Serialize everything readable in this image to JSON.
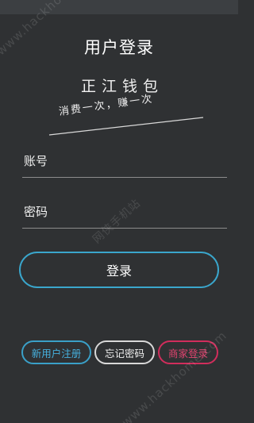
{
  "header": {
    "title": "用户登录"
  },
  "logo": {
    "name": "正江钱包",
    "slogan": "消费一次，赚一次"
  },
  "form": {
    "account_label": "账号",
    "password_label": "密码",
    "login_label": "登录"
  },
  "footer": {
    "register_label": "新用户注册",
    "forgot_label": "忘记密码",
    "merchant_label": "商家登录"
  },
  "watermarks": {
    "primary": "www.hackhome.com",
    "secondary": "www.hackhome.com",
    "center": "网侠手机站"
  },
  "colors": {
    "background": "#2f3133",
    "accent_blue": "#3aa6cc",
    "merchant_red": "#d12d5c",
    "divider": "#8c8c8c"
  }
}
